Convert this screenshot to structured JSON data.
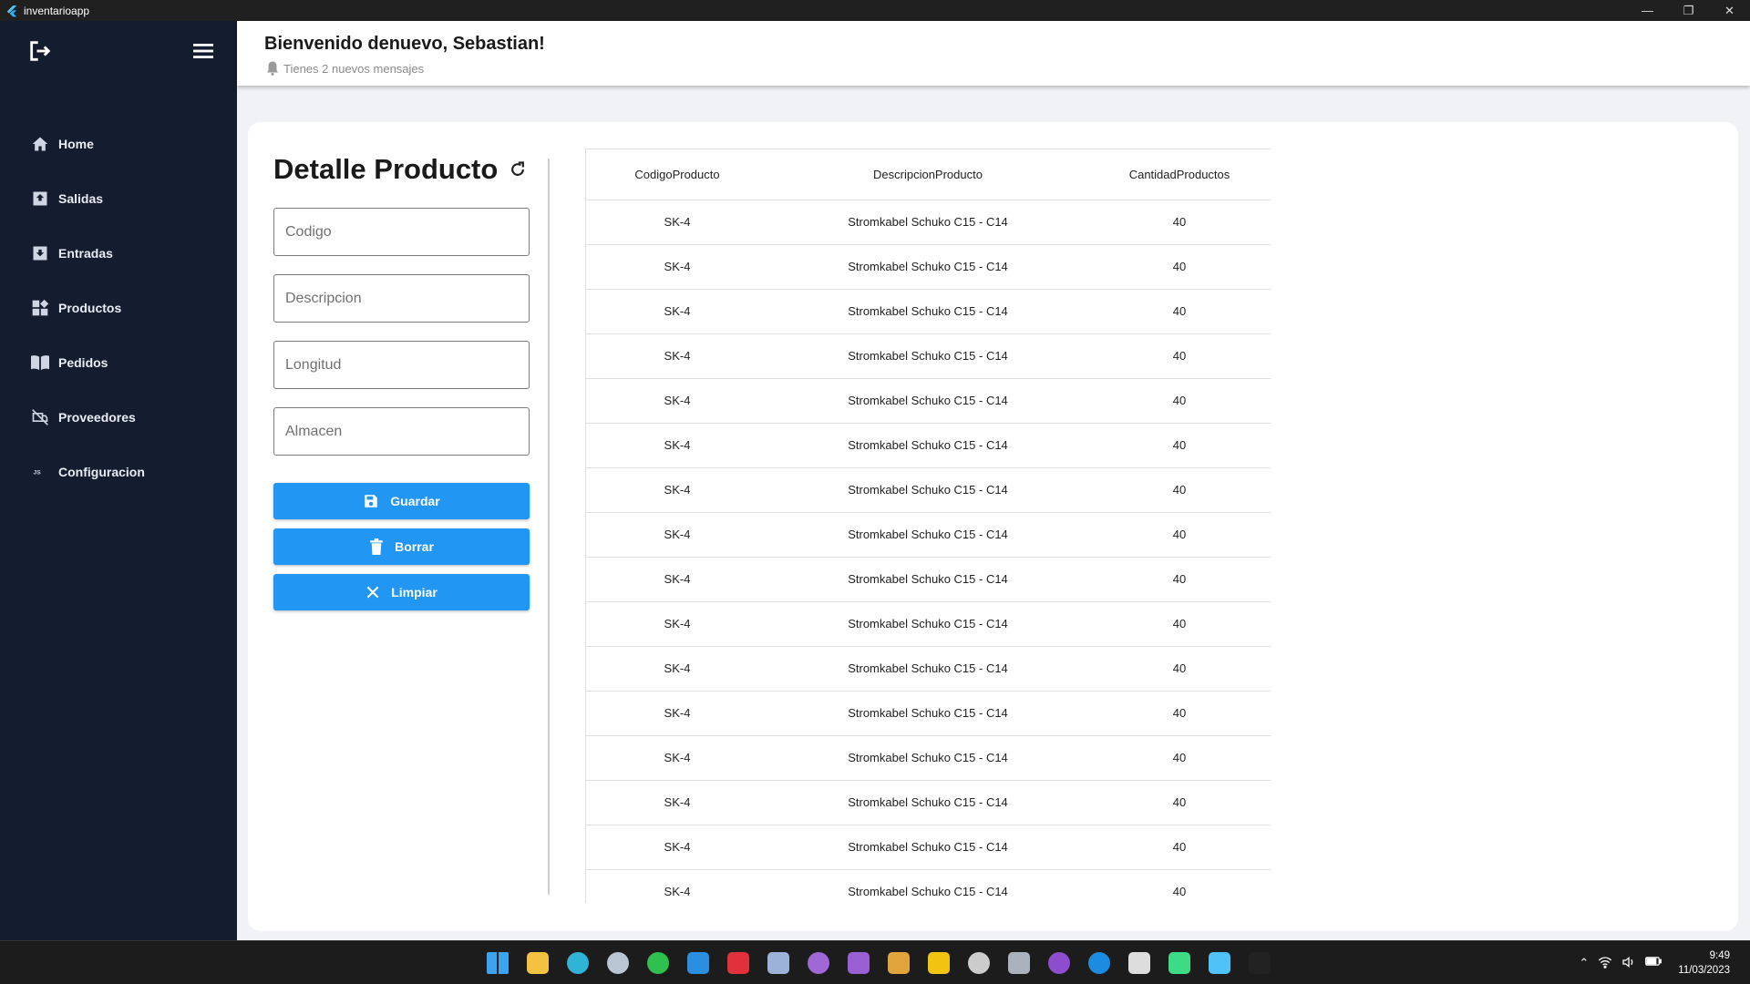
{
  "window": {
    "title": "inventarioapp",
    "minimize": "—",
    "restore": "❐",
    "close": "✕"
  },
  "sidebar": {
    "items": [
      {
        "label": "Home",
        "icon": "home-icon"
      },
      {
        "label": "Salidas",
        "icon": "outbox-icon"
      },
      {
        "label": "Entradas",
        "icon": "inbox-icon"
      },
      {
        "label": "Productos",
        "icon": "widgets-icon"
      },
      {
        "label": "Pedidos",
        "icon": "book-icon"
      },
      {
        "label": "Proveedores",
        "icon": "no-truck-icon"
      },
      {
        "label": "Configuracion",
        "icon": "js-icon"
      }
    ]
  },
  "header": {
    "greeting": "Bienvenido denuevo, Sebastian!",
    "messages": "Tienes 2 nuevos mensajes"
  },
  "detail": {
    "title": "Detalle Producto",
    "fields": {
      "codigo": "Codigo",
      "descripcion": "Descripcion",
      "longitud": "Longitud",
      "almacen": "Almacen"
    },
    "buttons": {
      "guardar": "Guardar",
      "borrar": "Borrar",
      "limpiar": "Limpiar"
    }
  },
  "table": {
    "headers": [
      "CodigoProducto",
      "DescripcionProducto",
      "CantidadProductos"
    ],
    "rows": [
      [
        "SK-4",
        "Stromkabel Schuko C15 - C14",
        "40"
      ],
      [
        "SK-4",
        "Stromkabel Schuko C15 - C14",
        "40"
      ],
      [
        "SK-4",
        "Stromkabel Schuko C15 - C14",
        "40"
      ],
      [
        "SK-4",
        "Stromkabel Schuko C15 - C14",
        "40"
      ],
      [
        "SK-4",
        "Stromkabel Schuko C15 - C14",
        "40"
      ],
      [
        "SK-4",
        "Stromkabel Schuko C15 - C14",
        "40"
      ],
      [
        "SK-4",
        "Stromkabel Schuko C15 - C14",
        "40"
      ],
      [
        "SK-4",
        "Stromkabel Schuko C15 - C14",
        "40"
      ],
      [
        "SK-4",
        "Stromkabel Schuko C15 - C14",
        "40"
      ],
      [
        "SK-4",
        "Stromkabel Schuko C15 - C14",
        "40"
      ],
      [
        "SK-4",
        "Stromkabel Schuko C15 - C14",
        "40"
      ],
      [
        "SK-4",
        "Stromkabel Schuko C15 - C14",
        "40"
      ],
      [
        "SK-4",
        "Stromkabel Schuko C15 - C14",
        "40"
      ],
      [
        "SK-4",
        "Stromkabel Schuko C15 - C14",
        "40"
      ],
      [
        "SK-4",
        "Stromkabel Schuko C15 - C14",
        "40"
      ],
      [
        "SK-4",
        "Stromkabel Schuko C15 - C14",
        "40"
      ]
    ]
  },
  "taskbar": {
    "apps": [
      {
        "name": "windows-start-icon",
        "color": "#3ba3f0"
      },
      {
        "name": "file-explorer-icon",
        "color": "#f4c243"
      },
      {
        "name": "edge-icon",
        "color": "#2fb3d6"
      },
      {
        "name": "steam-icon",
        "color": "#b8c6d4"
      },
      {
        "name": "whatsapp-icon",
        "color": "#30c04f"
      },
      {
        "name": "vscode-icon",
        "color": "#2a8fe0"
      },
      {
        "name": "anydesk-icon",
        "color": "#e0313d"
      },
      {
        "name": "virtualbox-icon",
        "color": "#9db2d8"
      },
      {
        "name": "github-desktop-icon",
        "color": "#a067d6"
      },
      {
        "name": "visual-studio-icon",
        "color": "#9b5fd4"
      },
      {
        "name": "xampp-icon",
        "color": "#e0a43a"
      },
      {
        "name": "sql-tool-icon",
        "color": "#f1c40f"
      },
      {
        "name": "unity-icon",
        "color": "#cccccc"
      },
      {
        "name": "database-icon",
        "color": "#aab3bd"
      },
      {
        "name": "tor-browser-icon",
        "color": "#8e4ccf"
      },
      {
        "name": "teamviewer-icon",
        "color": "#1b8ce0"
      },
      {
        "name": "cube-icon",
        "color": "#dddddd"
      },
      {
        "name": "android-studio-icon",
        "color": "#3ddc84"
      },
      {
        "name": "flutter-icon",
        "color": "#4fc3f7"
      },
      {
        "name": "brave-icon",
        "color": "#222222"
      }
    ],
    "time": "9:49",
    "date": "11/03/2023"
  }
}
